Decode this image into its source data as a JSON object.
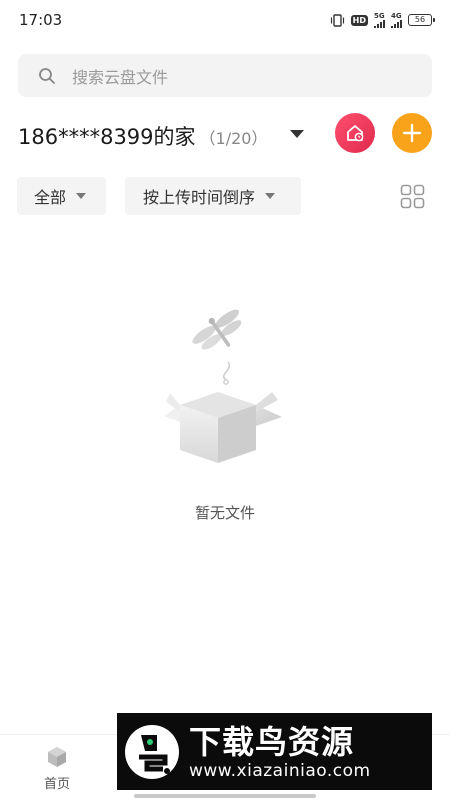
{
  "status_bar": {
    "time": "17:03",
    "hd_label": "HD",
    "net1": "5G",
    "net2": "4G",
    "battery": "56"
  },
  "search": {
    "placeholder": "搜索云盘文件",
    "icon": "search-icon"
  },
  "home": {
    "title": "186****8399的家",
    "count": "（1/20）",
    "dropdown_icon": "triangle-down-icon",
    "home_button_icon": "home-settings-icon",
    "add_button_icon": "plus-icon",
    "home_button_color": "#e8385a",
    "add_button_color": "#f9a31b"
  },
  "filters": {
    "type_label": "全部",
    "sort_label": "按上传时间倒序",
    "view_toggle_icon": "grid-view-icon"
  },
  "empty_state": {
    "message": "暂无文件",
    "illustration": "empty-box-dragonfly-icon"
  },
  "bottom_nav": {
    "items": [
      {
        "label": "首页",
        "icon": "cube-icon"
      }
    ]
  },
  "watermark": {
    "title": "下载鸟资源",
    "url": "www.xiazainiao.com"
  }
}
